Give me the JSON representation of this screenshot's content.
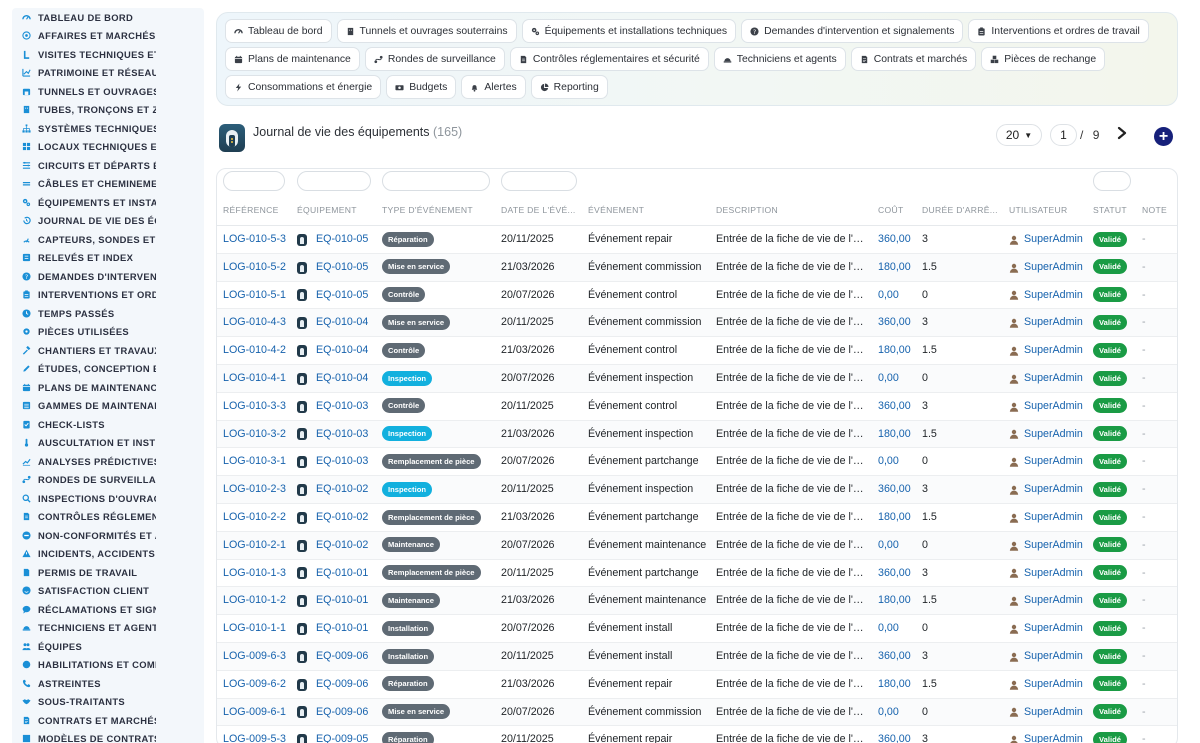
{
  "sidebar": {
    "items": [
      {
        "label": "TABLEAU DE BORD",
        "icon": "dashboard-icon"
      },
      {
        "label": "AFFAIRES ET MARCHÉS",
        "icon": "target-icon"
      },
      {
        "label": "VISITES TECHNIQUES ET",
        "icon": "walk-icon"
      },
      {
        "label": "PATRIMOINE ET RÉSEAUX",
        "icon": "chart-icon"
      },
      {
        "label": "TUNNELS ET OUVRAGES",
        "icon": "tunnel-icon"
      },
      {
        "label": "TUBES, TRONÇONS ET ZO",
        "icon": "building-icon"
      },
      {
        "label": "SYSTÈMES TECHNIQUES",
        "icon": "network-icon"
      },
      {
        "label": "LOCAUX TECHNIQUES ET",
        "icon": "grid-icon"
      },
      {
        "label": "CIRCUITS ET DÉPARTS ÉL",
        "icon": "circuit-icon"
      },
      {
        "label": "CÂBLES ET CHEMINEMEN",
        "icon": "cable-icon"
      },
      {
        "label": "ÉQUIPEMENTS ET INSTAL",
        "icon": "gears-icon"
      },
      {
        "label": "JOURNAL DE VIE DES ÉQ",
        "icon": "history-icon"
      },
      {
        "label": "CAPTEURS, SONDES ET C",
        "icon": "sensor-icon"
      },
      {
        "label": "RELEVÉS ET INDEX",
        "icon": "list-icon"
      },
      {
        "label": "DEMANDES D'INTERVENT",
        "icon": "question-icon"
      },
      {
        "label": "INTERVENTIONS ET ORDR",
        "icon": "clipboard-icon"
      },
      {
        "label": "TEMPS PASSÉS",
        "icon": "clock-icon"
      },
      {
        "label": "PIÈCES UTILISÉES",
        "icon": "cogs-icon"
      },
      {
        "label": "CHANTIERS ET TRAVAUX",
        "icon": "hammer-icon"
      },
      {
        "label": "ÉTUDES, CONCEPTION ET",
        "icon": "pencil-icon"
      },
      {
        "label": "PLANS DE MAINTENANCE",
        "icon": "calendar-icon"
      },
      {
        "label": "GAMMES DE MAINTENAN",
        "icon": "layers-icon"
      },
      {
        "label": "CHECK-LISTS",
        "icon": "checklist-icon"
      },
      {
        "label": "AUSCULTATION ET INSTR",
        "icon": "thermometer-icon"
      },
      {
        "label": "ANALYSES PRÉDICTIVES",
        "icon": "trend-icon"
      },
      {
        "label": "RONDES DE SURVEILLAN",
        "icon": "route-icon"
      },
      {
        "label": "INSPECTIONS D'OUVRAG",
        "icon": "search-icon"
      },
      {
        "label": "CONTRÔLES RÉGLEMENT",
        "icon": "document-icon"
      },
      {
        "label": "NON-CONFORMITÉS ET A",
        "icon": "ban-icon"
      },
      {
        "label": "INCIDENTS, ACCIDENTS E",
        "icon": "warning-icon"
      },
      {
        "label": "PERMIS DE TRAVAIL",
        "icon": "file-icon"
      },
      {
        "label": "SATISFACTION CLIENT",
        "icon": "smile-icon"
      },
      {
        "label": "RÉCLAMATIONS ET SIGN",
        "icon": "comment-icon"
      },
      {
        "label": "TECHNICIENS ET AGENTS",
        "icon": "helmet-icon"
      },
      {
        "label": "ÉQUIPES",
        "icon": "users-icon"
      },
      {
        "label": "HABILITATIONS ET COMP",
        "icon": "badge-icon"
      },
      {
        "label": "ASTREINTES",
        "icon": "phone-icon"
      },
      {
        "label": "SOUS-TRAITANTS",
        "icon": "handshake-icon"
      },
      {
        "label": "CONTRATS ET MARCHÉS",
        "icon": "contract-icon"
      },
      {
        "label": "MODÈLES DE CONTRATS",
        "icon": "template-icon"
      }
    ]
  },
  "topnav": [
    {
      "label": "Tableau de bord",
      "icon": "dashboard-icon"
    },
    {
      "label": "Tunnels et ouvrages souterrains",
      "icon": "building-icon"
    },
    {
      "label": "Équipements et installations techniques",
      "icon": "gears-icon"
    },
    {
      "label": "Demandes d'intervention et signalements",
      "icon": "question-icon"
    },
    {
      "label": "Interventions et ordres de travail",
      "icon": "clipboard-icon"
    },
    {
      "label": "Plans de maintenance",
      "icon": "calendar-icon"
    },
    {
      "label": "Rondes de surveillance",
      "icon": "route-icon"
    },
    {
      "label": "Contrôles réglementaires et sécurité",
      "icon": "document-icon"
    },
    {
      "label": "Techniciens et agents",
      "icon": "helmet-icon"
    },
    {
      "label": "Contrats et marchés",
      "icon": "contract-icon"
    },
    {
      "label": "Pièces de rechange",
      "icon": "cubes-icon"
    },
    {
      "label": "Consommations et énergie",
      "icon": "bolt-icon"
    },
    {
      "label": "Budgets",
      "icon": "money-icon"
    },
    {
      "label": "Alertes",
      "icon": "bell-icon"
    },
    {
      "label": "Reporting",
      "icon": "pie-icon"
    }
  ],
  "header": {
    "title": "Journal de vie des équipements",
    "count": "(165)",
    "per_page": "20",
    "current_page": "1",
    "page_separator": "/",
    "total_pages": "9",
    "add_label": "+"
  },
  "table": {
    "columns": [
      "RÉFÉRENCE",
      "ÉQUIPEMENT",
      "TYPE D'ÉVÉNEMENT",
      "DATE DE L'ÉVÉ...",
      "ÉVÉNEMENT",
      "DESCRIPTION",
      "COÛT",
      "DURÉE D'ARRÊ...",
      "UTILISATEUR",
      "STATUT",
      "NOTE"
    ],
    "rows": [
      {
        "ref": "LOG-010-5-3",
        "equip": "EQ-010-05",
        "type": "Réparation",
        "type_color": "gray",
        "date": "20/11/2025",
        "event": "Événement repair",
        "desc": "Entrée de la fiche de vie de l'équipement",
        "cost": "360,00",
        "duration": "3",
        "user": "SuperAdmin",
        "status": "Validé",
        "note": "-"
      },
      {
        "ref": "LOG-010-5-2",
        "equip": "EQ-010-05",
        "type": "Mise en service",
        "type_color": "gray",
        "date": "21/03/2026",
        "event": "Événement commission",
        "desc": "Entrée de la fiche de vie de l'équipement",
        "cost": "180,00",
        "duration": "1.5",
        "user": "SuperAdmin",
        "status": "Validé",
        "note": "-"
      },
      {
        "ref": "LOG-010-5-1",
        "equip": "EQ-010-05",
        "type": "Contrôle",
        "type_color": "gray",
        "date": "20/07/2026",
        "event": "Événement control",
        "desc": "Entrée de la fiche de vie de l'équipement",
        "cost": "0,00",
        "duration": "0",
        "user": "SuperAdmin",
        "status": "Validé",
        "note": "-"
      },
      {
        "ref": "LOG-010-4-3",
        "equip": "EQ-010-04",
        "type": "Mise en service",
        "type_color": "gray",
        "date": "20/11/2025",
        "event": "Événement commission",
        "desc": "Entrée de la fiche de vie de l'équipement",
        "cost": "360,00",
        "duration": "3",
        "user": "SuperAdmin",
        "status": "Validé",
        "note": "-"
      },
      {
        "ref": "LOG-010-4-2",
        "equip": "EQ-010-04",
        "type": "Contrôle",
        "type_color": "gray",
        "date": "21/03/2026",
        "event": "Événement control",
        "desc": "Entrée de la fiche de vie de l'équipement",
        "cost": "180,00",
        "duration": "1.5",
        "user": "SuperAdmin",
        "status": "Validé",
        "note": "-"
      },
      {
        "ref": "LOG-010-4-1",
        "equip": "EQ-010-04",
        "type": "Inspection",
        "type_color": "cyan",
        "date": "20/07/2026",
        "event": "Événement inspection",
        "desc": "Entrée de la fiche de vie de l'équipement",
        "cost": "0,00",
        "duration": "0",
        "user": "SuperAdmin",
        "status": "Validé",
        "note": "-"
      },
      {
        "ref": "LOG-010-3-3",
        "equip": "EQ-010-03",
        "type": "Contrôle",
        "type_color": "gray",
        "date": "20/11/2025",
        "event": "Événement control",
        "desc": "Entrée de la fiche de vie de l'équipement",
        "cost": "360,00",
        "duration": "3",
        "user": "SuperAdmin",
        "status": "Validé",
        "note": "-"
      },
      {
        "ref": "LOG-010-3-2",
        "equip": "EQ-010-03",
        "type": "Inspection",
        "type_color": "cyan",
        "date": "21/03/2026",
        "event": "Événement inspection",
        "desc": "Entrée de la fiche de vie de l'équipement",
        "cost": "180,00",
        "duration": "1.5",
        "user": "SuperAdmin",
        "status": "Validé",
        "note": "-"
      },
      {
        "ref": "LOG-010-3-1",
        "equip": "EQ-010-03",
        "type": "Remplacement de pièce",
        "type_color": "gray",
        "date": "20/07/2026",
        "event": "Événement partchange",
        "desc": "Entrée de la fiche de vie de l'équipement",
        "cost": "0,00",
        "duration": "0",
        "user": "SuperAdmin",
        "status": "Validé",
        "note": "-"
      },
      {
        "ref": "LOG-010-2-3",
        "equip": "EQ-010-02",
        "type": "Inspection",
        "type_color": "cyan",
        "date": "20/11/2025",
        "event": "Événement inspection",
        "desc": "Entrée de la fiche de vie de l'équipement",
        "cost": "360,00",
        "duration": "3",
        "user": "SuperAdmin",
        "status": "Validé",
        "note": "-"
      },
      {
        "ref": "LOG-010-2-2",
        "equip": "EQ-010-02",
        "type": "Remplacement de pièce",
        "type_color": "gray",
        "date": "21/03/2026",
        "event": "Événement partchange",
        "desc": "Entrée de la fiche de vie de l'équipement",
        "cost": "180,00",
        "duration": "1.5",
        "user": "SuperAdmin",
        "status": "Validé",
        "note": "-"
      },
      {
        "ref": "LOG-010-2-1",
        "equip": "EQ-010-02",
        "type": "Maintenance",
        "type_color": "gray",
        "date": "20/07/2026",
        "event": "Événement maintenance",
        "desc": "Entrée de la fiche de vie de l'équipement",
        "cost": "0,00",
        "duration": "0",
        "user": "SuperAdmin",
        "status": "Validé",
        "note": "-"
      },
      {
        "ref": "LOG-010-1-3",
        "equip": "EQ-010-01",
        "type": "Remplacement de pièce",
        "type_color": "gray",
        "date": "20/11/2025",
        "event": "Événement partchange",
        "desc": "Entrée de la fiche de vie de l'équipement",
        "cost": "360,00",
        "duration": "3",
        "user": "SuperAdmin",
        "status": "Validé",
        "note": "-"
      },
      {
        "ref": "LOG-010-1-2",
        "equip": "EQ-010-01",
        "type": "Maintenance",
        "type_color": "gray",
        "date": "21/03/2026",
        "event": "Événement maintenance",
        "desc": "Entrée de la fiche de vie de l'équipement",
        "cost": "180,00",
        "duration": "1.5",
        "user": "SuperAdmin",
        "status": "Validé",
        "note": "-"
      },
      {
        "ref": "LOG-010-1-1",
        "equip": "EQ-010-01",
        "type": "Installation",
        "type_color": "gray",
        "date": "20/07/2026",
        "event": "Événement install",
        "desc": "Entrée de la fiche de vie de l'équipement",
        "cost": "0,00",
        "duration": "0",
        "user": "SuperAdmin",
        "status": "Validé",
        "note": "-"
      },
      {
        "ref": "LOG-009-6-3",
        "equip": "EQ-009-06",
        "type": "Installation",
        "type_color": "gray",
        "date": "20/11/2025",
        "event": "Événement install",
        "desc": "Entrée de la fiche de vie de l'équipement",
        "cost": "360,00",
        "duration": "3",
        "user": "SuperAdmin",
        "status": "Validé",
        "note": "-"
      },
      {
        "ref": "LOG-009-6-2",
        "equip": "EQ-009-06",
        "type": "Réparation",
        "type_color": "gray",
        "date": "21/03/2026",
        "event": "Événement repair",
        "desc": "Entrée de la fiche de vie de l'équipement",
        "cost": "180,00",
        "duration": "1.5",
        "user": "SuperAdmin",
        "status": "Validé",
        "note": "-"
      },
      {
        "ref": "LOG-009-6-1",
        "equip": "EQ-009-06",
        "type": "Mise en service",
        "type_color": "gray",
        "date": "20/07/2026",
        "event": "Événement commission",
        "desc": "Entrée de la fiche de vie de l'équipement",
        "cost": "0,00",
        "duration": "0",
        "user": "SuperAdmin",
        "status": "Validé",
        "note": "-"
      },
      {
        "ref": "LOG-009-5-3",
        "equip": "EQ-009-05",
        "type": "Réparation",
        "type_color": "gray",
        "date": "20/11/2025",
        "event": "Événement repair",
        "desc": "Entrée de la fiche de vie de l'équipement",
        "cost": "360,00",
        "duration": "3",
        "user": "SuperAdmin",
        "status": "Validé",
        "note": "-"
      }
    ]
  },
  "colors": {
    "link": "#1662ad",
    "badge_gray": "#5f6a74",
    "badge_cyan": "#12b0de",
    "status_green": "#1a9b45",
    "add_button": "#16207a",
    "sidebar_icon": "#1a8fd6"
  }
}
